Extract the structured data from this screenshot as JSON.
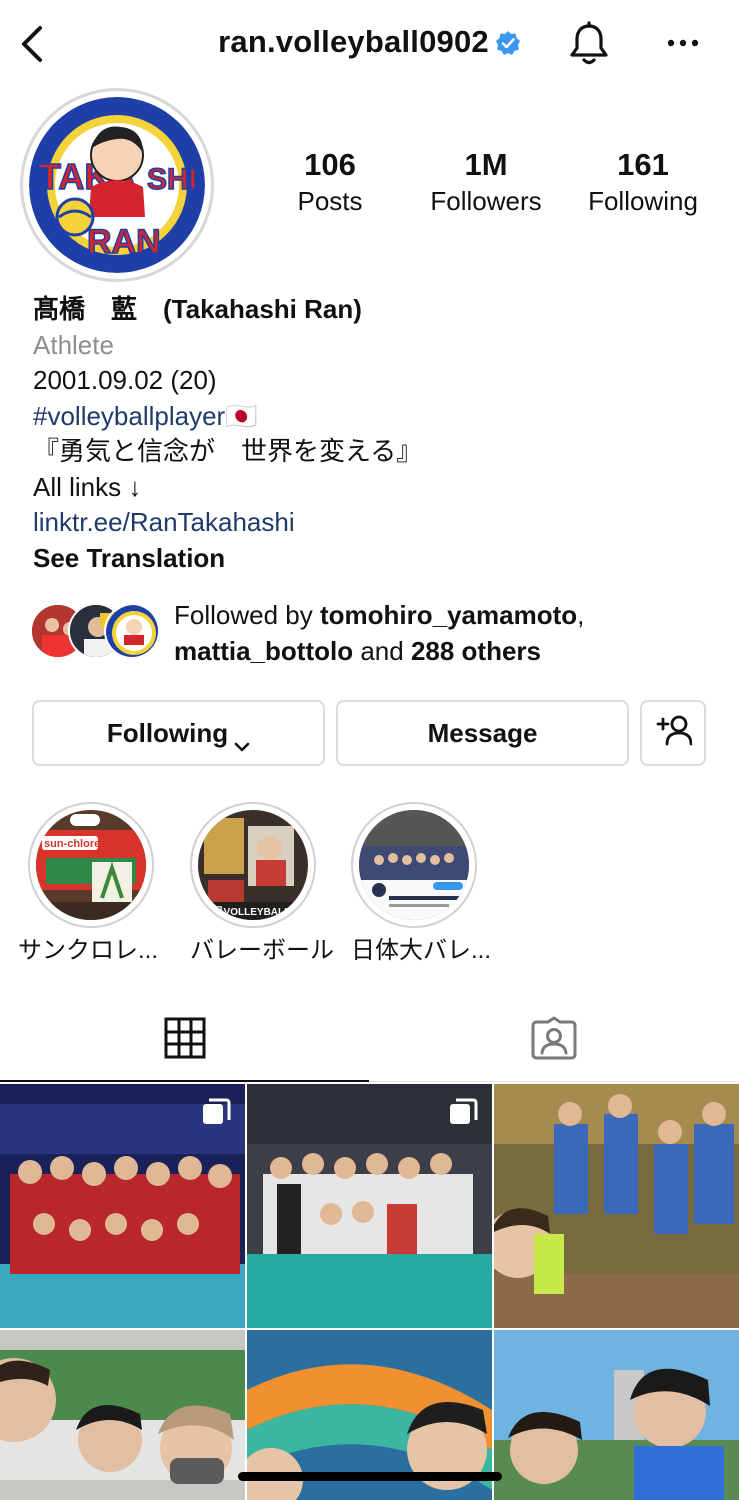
{
  "header": {
    "username": "ran.volleyball0902",
    "verified": true,
    "icons": [
      "back-icon",
      "verified-badge-icon",
      "bell-icon",
      "more-icon"
    ]
  },
  "avatar": {
    "lettering": "TAKAHASHI RAN"
  },
  "stats": {
    "posts": {
      "value": "106",
      "label": "Posts"
    },
    "followers": {
      "value": "1M",
      "label": "Followers"
    },
    "following": {
      "value": "161",
      "label": "Following"
    }
  },
  "bio": {
    "name": "髙橋　藍　(Takahashi Ran)",
    "category": "Athlete",
    "birthday": "2001.09.02 (20)",
    "hashtag": "#volleyballplayer",
    "flag": "🇯🇵",
    "quote": "『勇気と信念が　世界を変える』",
    "links_line": "All links ↓",
    "link": "linktr.ee/RanTakahashi",
    "translate": "See Translation"
  },
  "followed_by": {
    "prefix": "Followed by ",
    "user1": "tomohiro_yamamoto",
    "comma": ",",
    "user2": "mattia_bottolo",
    "and": " and ",
    "others": "288 others"
  },
  "buttons": {
    "following": "Following",
    "message": "Message"
  },
  "highlights": [
    {
      "label": "サンクロレ..."
    },
    {
      "label": "バレーボール"
    },
    {
      "label": "日体大バレ..."
    }
  ],
  "tabs": [
    "grid-icon",
    "tagged-icon"
  ],
  "colors": {
    "verified": "#3897f0",
    "link": "#1f3a6b",
    "secondary_text": "#8e8e8e",
    "border": "#dbdbdb"
  }
}
